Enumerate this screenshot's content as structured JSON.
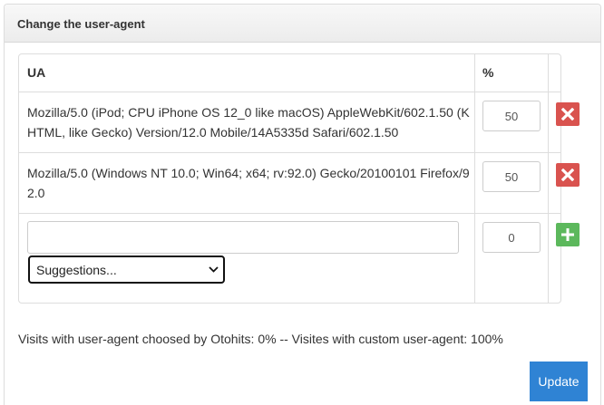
{
  "panel": {
    "title": "Change the user-agent"
  },
  "table": {
    "headers": {
      "ua": "UA",
      "percent": "%"
    },
    "rows": [
      {
        "ua": "Mozilla/5.0 (iPod; CPU iPhone OS 12_0 like macOS) AppleWebKit/602.1.50 (KHTML, like Gecko) Version/12.0 Mobile/14A5335d Safari/602.1.50",
        "percent": "50",
        "action_icon": "close-icon",
        "action_color": "#d9534f"
      },
      {
        "ua": "Mozilla/5.0 (Windows NT 10.0; Win64; x64; rv:92.0) Gecko/20100101 Firefox/92.0",
        "percent": "50",
        "action_icon": "close-icon",
        "action_color": "#d9534f"
      }
    ],
    "new_row": {
      "ua_value": "",
      "percent": "0",
      "suggestions_selected": "Suggestions...",
      "action_icon": "plus-icon",
      "action_color": "#5cb85c"
    }
  },
  "stats_text": "Visits with user-agent choosed by Otohits: 0% -- Visites with custom user-agent: 100%",
  "update_label": "Update",
  "colors": {
    "primary": "#2f83d4",
    "danger": "#d9534f",
    "success": "#5cb85c"
  }
}
